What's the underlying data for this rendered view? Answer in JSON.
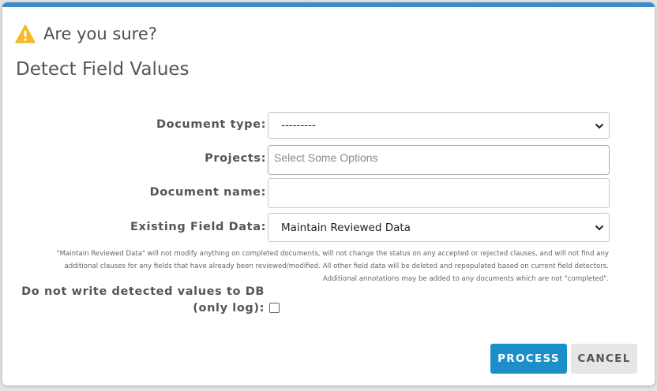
{
  "modal": {
    "title": "Are you sure?",
    "subtitle": "Detect Field Values"
  },
  "form": {
    "document_type": {
      "label": "Document type:",
      "value": "---------"
    },
    "projects": {
      "label": "Projects:",
      "placeholder": "Select Some Options"
    },
    "document_name": {
      "label": "Document name:",
      "value": ""
    },
    "existing_field_data": {
      "label": "Existing Field Data:",
      "value": "Maintain Reviewed Data"
    },
    "help_text": [
      "\"Maintain Reviewed Data\" will not modify anything on completed documents, will not change the status on any accepted or rejected clauses, and will not find any",
      "additional clauses for any fields that have already been reviewed/modified. All other field data will be deleted and repopulated based on current field detectors.",
      "Additional annotations may be added to any documents which are not \"completed\"."
    ],
    "no_write": {
      "label_line1": "Do not write detected values to DB",
      "label_line2": "(only log):",
      "checked": false
    }
  },
  "buttons": {
    "process": "PROCESS",
    "cancel": "CANCEL"
  },
  "colors": {
    "accent": "#1d8fc8",
    "topbar": "#3c8ccd",
    "warning": "#f5b92a"
  },
  "icons": {
    "title": "warning-icon",
    "select": "chevron-down-icon"
  }
}
